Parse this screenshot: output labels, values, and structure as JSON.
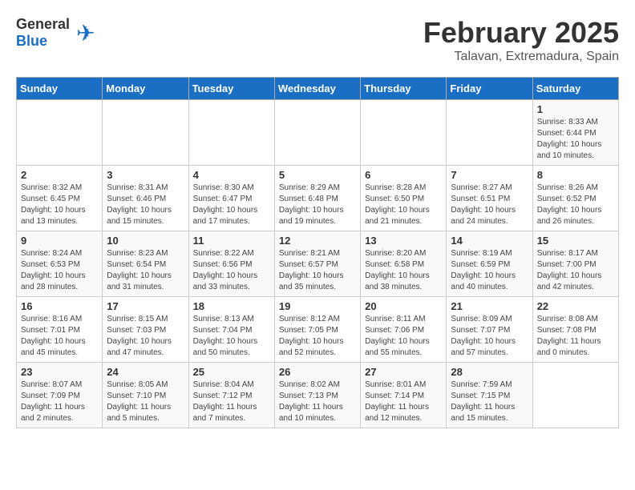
{
  "header": {
    "logo_general": "General",
    "logo_blue": "Blue",
    "month_title": "February 2025",
    "location": "Talavan, Extremadura, Spain"
  },
  "days_of_week": [
    "Sunday",
    "Monday",
    "Tuesday",
    "Wednesday",
    "Thursday",
    "Friday",
    "Saturday"
  ],
  "weeks": [
    [
      {
        "day": null
      },
      {
        "day": null
      },
      {
        "day": null
      },
      {
        "day": null
      },
      {
        "day": null
      },
      {
        "day": null
      },
      {
        "day": 1,
        "sunrise": "8:33 AM",
        "sunset": "6:44 PM",
        "daylight": "10 hours and 10 minutes."
      }
    ],
    [
      {
        "day": 2,
        "sunrise": "8:32 AM",
        "sunset": "6:45 PM",
        "daylight": "10 hours and 13 minutes."
      },
      {
        "day": 3,
        "sunrise": "8:31 AM",
        "sunset": "6:46 PM",
        "daylight": "10 hours and 15 minutes."
      },
      {
        "day": 4,
        "sunrise": "8:30 AM",
        "sunset": "6:47 PM",
        "daylight": "10 hours and 17 minutes."
      },
      {
        "day": 5,
        "sunrise": "8:29 AM",
        "sunset": "6:48 PM",
        "daylight": "10 hours and 19 minutes."
      },
      {
        "day": 6,
        "sunrise": "8:28 AM",
        "sunset": "6:50 PM",
        "daylight": "10 hours and 21 minutes."
      },
      {
        "day": 7,
        "sunrise": "8:27 AM",
        "sunset": "6:51 PM",
        "daylight": "10 hours and 24 minutes."
      },
      {
        "day": 8,
        "sunrise": "8:26 AM",
        "sunset": "6:52 PM",
        "daylight": "10 hours and 26 minutes."
      }
    ],
    [
      {
        "day": 9,
        "sunrise": "8:24 AM",
        "sunset": "6:53 PM",
        "daylight": "10 hours and 28 minutes."
      },
      {
        "day": 10,
        "sunrise": "8:23 AM",
        "sunset": "6:54 PM",
        "daylight": "10 hours and 31 minutes."
      },
      {
        "day": 11,
        "sunrise": "8:22 AM",
        "sunset": "6:56 PM",
        "daylight": "10 hours and 33 minutes."
      },
      {
        "day": 12,
        "sunrise": "8:21 AM",
        "sunset": "6:57 PM",
        "daylight": "10 hours and 35 minutes."
      },
      {
        "day": 13,
        "sunrise": "8:20 AM",
        "sunset": "6:58 PM",
        "daylight": "10 hours and 38 minutes."
      },
      {
        "day": 14,
        "sunrise": "8:19 AM",
        "sunset": "6:59 PM",
        "daylight": "10 hours and 40 minutes."
      },
      {
        "day": 15,
        "sunrise": "8:17 AM",
        "sunset": "7:00 PM",
        "daylight": "10 hours and 42 minutes."
      }
    ],
    [
      {
        "day": 16,
        "sunrise": "8:16 AM",
        "sunset": "7:01 PM",
        "daylight": "10 hours and 45 minutes."
      },
      {
        "day": 17,
        "sunrise": "8:15 AM",
        "sunset": "7:03 PM",
        "daylight": "10 hours and 47 minutes."
      },
      {
        "day": 18,
        "sunrise": "8:13 AM",
        "sunset": "7:04 PM",
        "daylight": "10 hours and 50 minutes."
      },
      {
        "day": 19,
        "sunrise": "8:12 AM",
        "sunset": "7:05 PM",
        "daylight": "10 hours and 52 minutes."
      },
      {
        "day": 20,
        "sunrise": "8:11 AM",
        "sunset": "7:06 PM",
        "daylight": "10 hours and 55 minutes."
      },
      {
        "day": 21,
        "sunrise": "8:09 AM",
        "sunset": "7:07 PM",
        "daylight": "10 hours and 57 minutes."
      },
      {
        "day": 22,
        "sunrise": "8:08 AM",
        "sunset": "7:08 PM",
        "daylight": "11 hours and 0 minutes."
      }
    ],
    [
      {
        "day": 23,
        "sunrise": "8:07 AM",
        "sunset": "7:09 PM",
        "daylight": "11 hours and 2 minutes."
      },
      {
        "day": 24,
        "sunrise": "8:05 AM",
        "sunset": "7:10 PM",
        "daylight": "11 hours and 5 minutes."
      },
      {
        "day": 25,
        "sunrise": "8:04 AM",
        "sunset": "7:12 PM",
        "daylight": "11 hours and 7 minutes."
      },
      {
        "day": 26,
        "sunrise": "8:02 AM",
        "sunset": "7:13 PM",
        "daylight": "11 hours and 10 minutes."
      },
      {
        "day": 27,
        "sunrise": "8:01 AM",
        "sunset": "7:14 PM",
        "daylight": "11 hours and 12 minutes."
      },
      {
        "day": 28,
        "sunrise": "7:59 AM",
        "sunset": "7:15 PM",
        "daylight": "11 hours and 15 minutes."
      },
      {
        "day": null
      }
    ]
  ]
}
